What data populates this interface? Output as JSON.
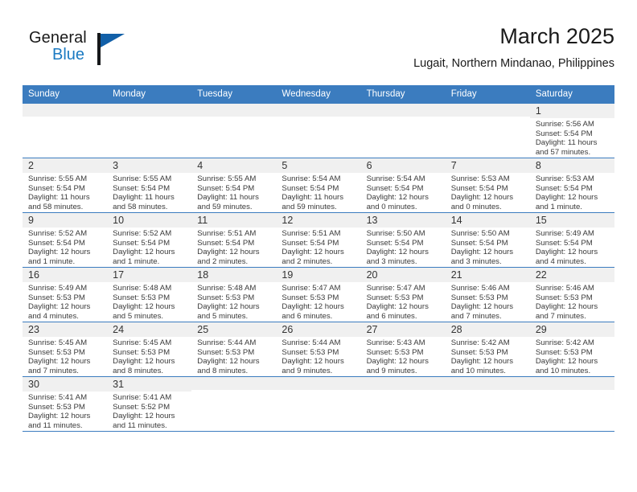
{
  "brand": {
    "name_part1": "General",
    "name_part2": "Blue",
    "flag_icon": "flag-icon"
  },
  "header": {
    "month_title": "March 2025",
    "location": "Lugait, Northern Mindanao, Philippines"
  },
  "calendar": {
    "weekday_headers": [
      "Sunday",
      "Monday",
      "Tuesday",
      "Wednesday",
      "Thursday",
      "Friday",
      "Saturday"
    ],
    "accent_color": "#3b7cbf",
    "daynum_bg": "#f0f0f0",
    "weeks": [
      [
        {
          "blank": true
        },
        {
          "blank": true
        },
        {
          "blank": true
        },
        {
          "blank": true
        },
        {
          "blank": true
        },
        {
          "blank": true
        },
        {
          "day": "1",
          "sunrise": "Sunrise: 5:56 AM",
          "sunset": "Sunset: 5:54 PM",
          "daylight": "Daylight: 11 hours and 57 minutes."
        }
      ],
      [
        {
          "day": "2",
          "sunrise": "Sunrise: 5:55 AM",
          "sunset": "Sunset: 5:54 PM",
          "daylight": "Daylight: 11 hours and 58 minutes."
        },
        {
          "day": "3",
          "sunrise": "Sunrise: 5:55 AM",
          "sunset": "Sunset: 5:54 PM",
          "daylight": "Daylight: 11 hours and 58 minutes."
        },
        {
          "day": "4",
          "sunrise": "Sunrise: 5:55 AM",
          "sunset": "Sunset: 5:54 PM",
          "daylight": "Daylight: 11 hours and 59 minutes."
        },
        {
          "day": "5",
          "sunrise": "Sunrise: 5:54 AM",
          "sunset": "Sunset: 5:54 PM",
          "daylight": "Daylight: 11 hours and 59 minutes."
        },
        {
          "day": "6",
          "sunrise": "Sunrise: 5:54 AM",
          "sunset": "Sunset: 5:54 PM",
          "daylight": "Daylight: 12 hours and 0 minutes."
        },
        {
          "day": "7",
          "sunrise": "Sunrise: 5:53 AM",
          "sunset": "Sunset: 5:54 PM",
          "daylight": "Daylight: 12 hours and 0 minutes."
        },
        {
          "day": "8",
          "sunrise": "Sunrise: 5:53 AM",
          "sunset": "Sunset: 5:54 PM",
          "daylight": "Daylight: 12 hours and 1 minute."
        }
      ],
      [
        {
          "day": "9",
          "sunrise": "Sunrise: 5:52 AM",
          "sunset": "Sunset: 5:54 PM",
          "daylight": "Daylight: 12 hours and 1 minute."
        },
        {
          "day": "10",
          "sunrise": "Sunrise: 5:52 AM",
          "sunset": "Sunset: 5:54 PM",
          "daylight": "Daylight: 12 hours and 1 minute."
        },
        {
          "day": "11",
          "sunrise": "Sunrise: 5:51 AM",
          "sunset": "Sunset: 5:54 PM",
          "daylight": "Daylight: 12 hours and 2 minutes."
        },
        {
          "day": "12",
          "sunrise": "Sunrise: 5:51 AM",
          "sunset": "Sunset: 5:54 PM",
          "daylight": "Daylight: 12 hours and 2 minutes."
        },
        {
          "day": "13",
          "sunrise": "Sunrise: 5:50 AM",
          "sunset": "Sunset: 5:54 PM",
          "daylight": "Daylight: 12 hours and 3 minutes."
        },
        {
          "day": "14",
          "sunrise": "Sunrise: 5:50 AM",
          "sunset": "Sunset: 5:54 PM",
          "daylight": "Daylight: 12 hours and 3 minutes."
        },
        {
          "day": "15",
          "sunrise": "Sunrise: 5:49 AM",
          "sunset": "Sunset: 5:54 PM",
          "daylight": "Daylight: 12 hours and 4 minutes."
        }
      ],
      [
        {
          "day": "16",
          "sunrise": "Sunrise: 5:49 AM",
          "sunset": "Sunset: 5:53 PM",
          "daylight": "Daylight: 12 hours and 4 minutes."
        },
        {
          "day": "17",
          "sunrise": "Sunrise: 5:48 AM",
          "sunset": "Sunset: 5:53 PM",
          "daylight": "Daylight: 12 hours and 5 minutes."
        },
        {
          "day": "18",
          "sunrise": "Sunrise: 5:48 AM",
          "sunset": "Sunset: 5:53 PM",
          "daylight": "Daylight: 12 hours and 5 minutes."
        },
        {
          "day": "19",
          "sunrise": "Sunrise: 5:47 AM",
          "sunset": "Sunset: 5:53 PM",
          "daylight": "Daylight: 12 hours and 6 minutes."
        },
        {
          "day": "20",
          "sunrise": "Sunrise: 5:47 AM",
          "sunset": "Sunset: 5:53 PM",
          "daylight": "Daylight: 12 hours and 6 minutes."
        },
        {
          "day": "21",
          "sunrise": "Sunrise: 5:46 AM",
          "sunset": "Sunset: 5:53 PM",
          "daylight": "Daylight: 12 hours and 7 minutes."
        },
        {
          "day": "22",
          "sunrise": "Sunrise: 5:46 AM",
          "sunset": "Sunset: 5:53 PM",
          "daylight": "Daylight: 12 hours and 7 minutes."
        }
      ],
      [
        {
          "day": "23",
          "sunrise": "Sunrise: 5:45 AM",
          "sunset": "Sunset: 5:53 PM",
          "daylight": "Daylight: 12 hours and 7 minutes."
        },
        {
          "day": "24",
          "sunrise": "Sunrise: 5:45 AM",
          "sunset": "Sunset: 5:53 PM",
          "daylight": "Daylight: 12 hours and 8 minutes."
        },
        {
          "day": "25",
          "sunrise": "Sunrise: 5:44 AM",
          "sunset": "Sunset: 5:53 PM",
          "daylight": "Daylight: 12 hours and 8 minutes."
        },
        {
          "day": "26",
          "sunrise": "Sunrise: 5:44 AM",
          "sunset": "Sunset: 5:53 PM",
          "daylight": "Daylight: 12 hours and 9 minutes."
        },
        {
          "day": "27",
          "sunrise": "Sunrise: 5:43 AM",
          "sunset": "Sunset: 5:53 PM",
          "daylight": "Daylight: 12 hours and 9 minutes."
        },
        {
          "day": "28",
          "sunrise": "Sunrise: 5:42 AM",
          "sunset": "Sunset: 5:53 PM",
          "daylight": "Daylight: 12 hours and 10 minutes."
        },
        {
          "day": "29",
          "sunrise": "Sunrise: 5:42 AM",
          "sunset": "Sunset: 5:53 PM",
          "daylight": "Daylight: 12 hours and 10 minutes."
        }
      ],
      [
        {
          "day": "30",
          "sunrise": "Sunrise: 5:41 AM",
          "sunset": "Sunset: 5:53 PM",
          "daylight": "Daylight: 12 hours and 11 minutes."
        },
        {
          "day": "31",
          "sunrise": "Sunrise: 5:41 AM",
          "sunset": "Sunset: 5:52 PM",
          "daylight": "Daylight: 12 hours and 11 minutes."
        },
        {
          "blank": true
        },
        {
          "blank": true
        },
        {
          "blank": true
        },
        {
          "blank": true
        },
        {
          "blank": true
        }
      ]
    ]
  }
}
